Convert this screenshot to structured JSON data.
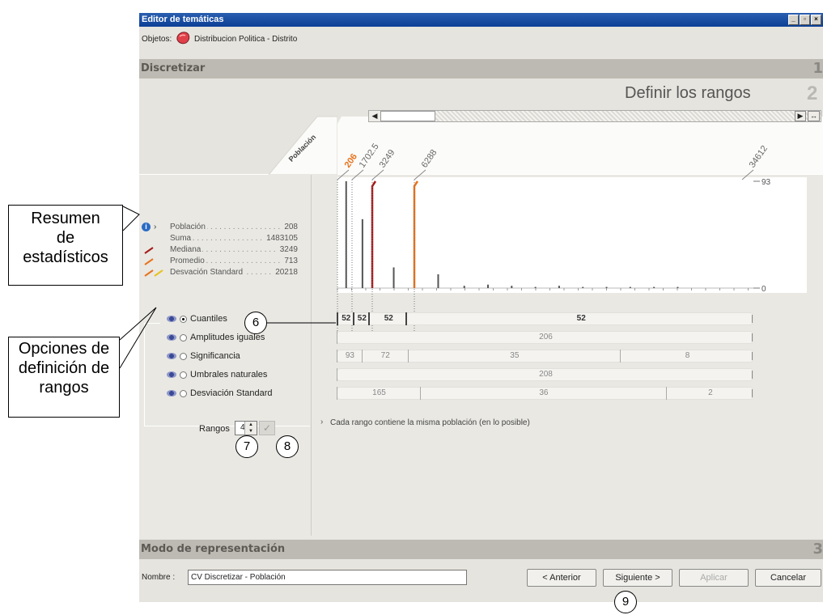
{
  "window": {
    "title": "Editor de temáticas",
    "controls": [
      "_",
      "▫",
      "×"
    ]
  },
  "objects": {
    "label": "Objetos:",
    "value": "Distribucion Politica - Distrito"
  },
  "sections": {
    "s1": {
      "title": "Discretizar",
      "num": "1"
    },
    "s2": {
      "title": "Definir los rangos",
      "num": "2"
    },
    "s3": {
      "title": "Modo de representación",
      "num": "3"
    }
  },
  "field_label": "Población",
  "top_ticks": [
    "206",
    "1702.5",
    "3249",
    "6288",
    "34612"
  ],
  "y_axis": {
    "max": "93",
    "min": "0"
  },
  "stats": {
    "rows": [
      {
        "label": "Población",
        "value": "208"
      },
      {
        "label": "Suma",
        "value": "1483105"
      },
      {
        "label": "Mediana",
        "value": "3249"
      },
      {
        "label": "Promedio",
        "value": "713"
      },
      {
        "label": "Desvación Standard",
        "value": "20218"
      }
    ]
  },
  "options": [
    {
      "label": "Cuantiles",
      "selected": true,
      "ranges": [
        "52",
        "52",
        "52",
        "52"
      ]
    },
    {
      "label": "Amplitudes iguales",
      "selected": false,
      "ranges": [
        "206"
      ]
    },
    {
      "label": "Significancia",
      "selected": false,
      "ranges": [
        "93",
        "72",
        "35",
        "8"
      ]
    },
    {
      "label": "Umbrales naturales",
      "selected": false,
      "ranges": [
        "208"
      ]
    },
    {
      "label": "Desviación Standard",
      "selected": false,
      "ranges": [
        "165",
        "36",
        "2"
      ]
    }
  ],
  "rangos": {
    "label": "Rangos",
    "value": "4"
  },
  "hint": "Cada rango contiene la misma población (en lo posible)",
  "footer": {
    "name_label": "Nombre :",
    "name_value": "CV Discretizar - Población",
    "prev": "< Anterior",
    "next": "Siguiente >",
    "apply": "Aplicar",
    "cancel": "Cancelar"
  },
  "annotations": {
    "resumen": [
      "Resumen",
      "de",
      "estadísticos"
    ],
    "opciones": [
      "Opciones de",
      "definición de",
      "rangos"
    ],
    "n6": "6",
    "n7": "7",
    "n8": "8",
    "n9": "9"
  },
  "colors": {
    "title_bar": "#0b3f96",
    "median": "#a51a1a",
    "mean": "#e8731e",
    "accent_206": "#e8731e"
  },
  "chart_data": {
    "type": "bar",
    "xlim": [
      206,
      34612
    ],
    "ylim": [
      0,
      93
    ],
    "breaks": [
      206,
      1702.5,
      3249,
      6288,
      34612
    ],
    "median": 3249,
    "mean": 713,
    "bars": [
      {
        "x": 1100,
        "y": 93
      },
      {
        "x": 2500,
        "y": 60
      },
      {
        "x": 4800,
        "y": 18
      },
      {
        "x": 6288,
        "y": 14
      },
      {
        "x": 8300,
        "y": 12
      },
      {
        "x": 10500,
        "y": 2
      },
      {
        "x": 12500,
        "y": 3
      },
      {
        "x": 14500,
        "y": 2
      },
      {
        "x": 16500,
        "y": 1
      },
      {
        "x": 18500,
        "y": 2
      },
      {
        "x": 20500,
        "y": 1
      },
      {
        "x": 22500,
        "y": 1
      },
      {
        "x": 24500,
        "y": 1
      },
      {
        "x": 26500,
        "y": 1
      },
      {
        "x": 28500,
        "y": 1
      }
    ]
  }
}
